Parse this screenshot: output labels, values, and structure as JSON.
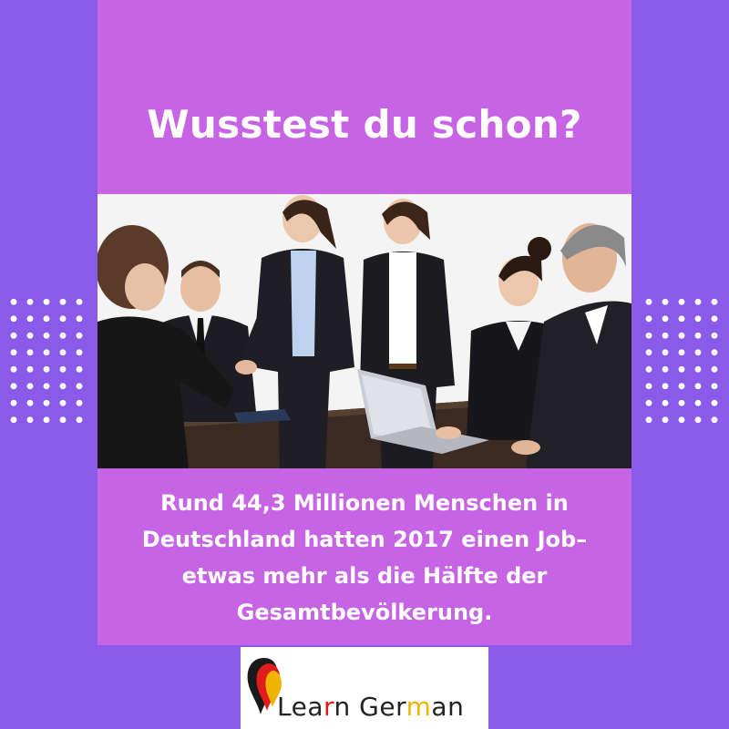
{
  "headline": "Wusstest du schon?",
  "body_lines": [
    "Rund 44,3 Millionen Menschen in",
    "Deutschland hatten 2017 einen Job–",
    "etwas mehr als die Hälfte der",
    "Gesamtbevölkerung."
  ],
  "logo": {
    "part1": "Lea",
    "part2": "r",
    "part3": "n Ger",
    "part4": "m",
    "part5": "an"
  },
  "colors": {
    "background": "#8a5ae9",
    "card": "#c764e6",
    "text": "#ffffff",
    "logo_red": "#e01c1c",
    "logo_gold": "#f0b400"
  },
  "photo": {
    "subject": "business-meeting-handshake"
  }
}
